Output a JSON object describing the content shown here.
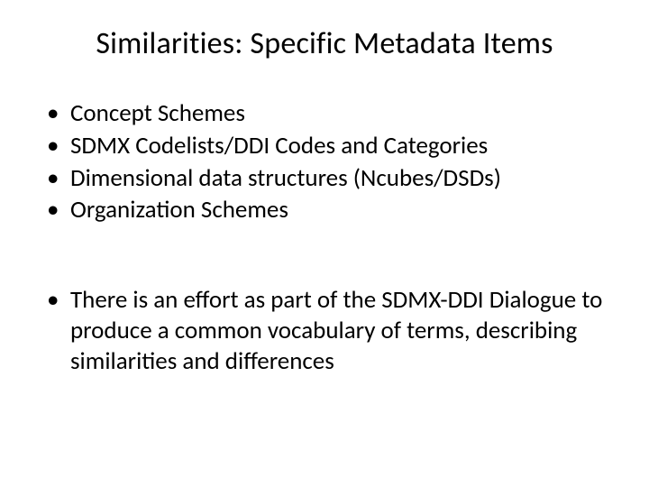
{
  "title": "Similarities: Specific Metadata Items",
  "bullets1": [
    "Concept Schemes",
    "SDMX Codelists/DDI Codes and Categories",
    "Dimensional data structures (Ncubes/DSDs)",
    "Organization Schemes"
  ],
  "bullets2": [
    "There is an effort as part of the SDMX-DDI Dialogue to produce a common vocabulary of terms, describing similarities and differences"
  ]
}
